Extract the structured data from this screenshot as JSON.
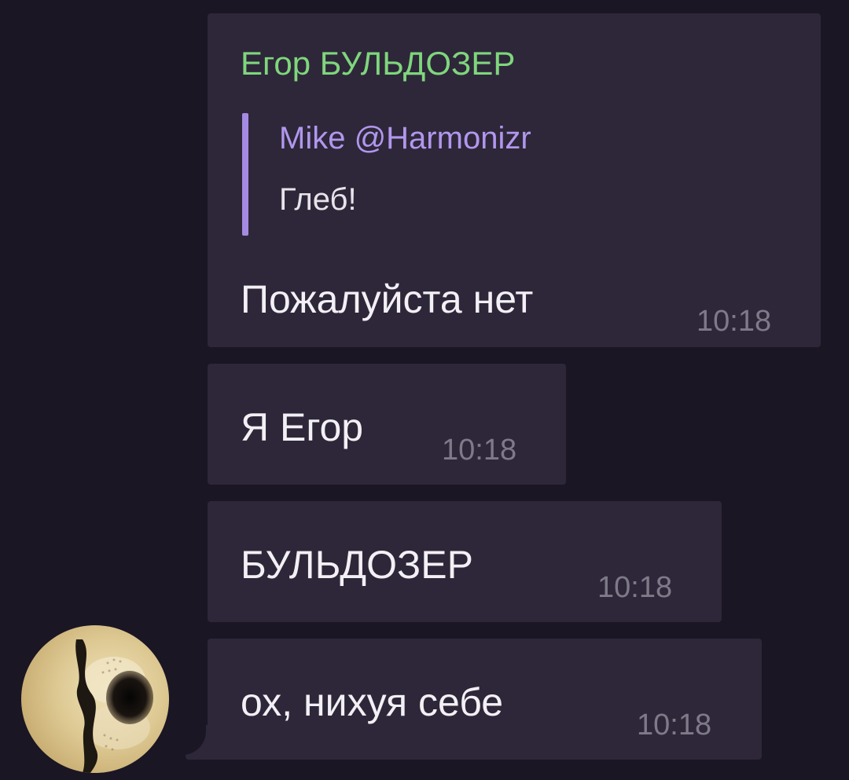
{
  "messages": [
    {
      "sender": "Егор БУЛЬДОЗЕР",
      "reply": {
        "author": "Mike @Harmonizr",
        "text": "Глеб!"
      },
      "text": "Пожалуйста нет",
      "time": "10:18"
    },
    {
      "text": "Я Егор",
      "time": "10:18"
    },
    {
      "text": "БУЛЬДОЗЕР",
      "time": "10:18"
    },
    {
      "text": "ох, нихуя себе",
      "time": "10:18"
    }
  ],
  "colors": {
    "background": "#1a1624",
    "bubble": "#2e2739",
    "sender_name": "#7fd67d",
    "reply_accent": "#b197ee",
    "timestamp": "#7e7a89"
  },
  "avatar": {
    "icon": "user-avatar-photo"
  }
}
